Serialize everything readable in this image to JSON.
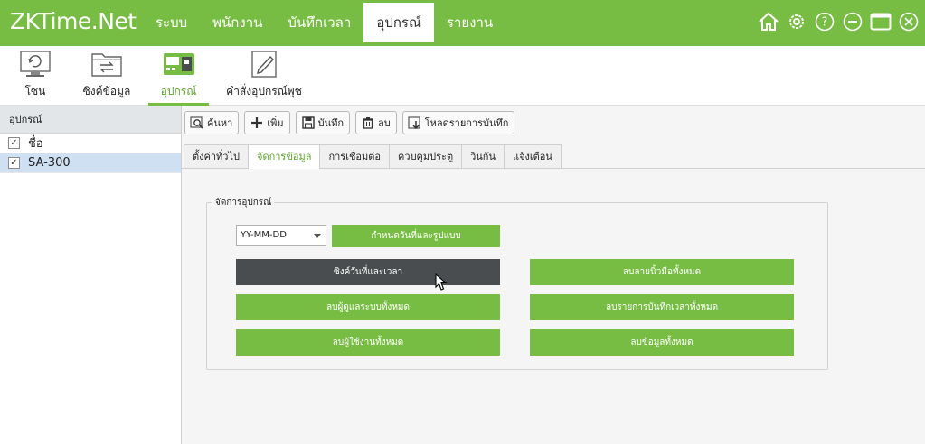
{
  "app": {
    "logo_main": "ZKTime",
    "logo_suffix": ".Net"
  },
  "nav": {
    "items": [
      {
        "label": "ระบบ"
      },
      {
        "label": "พนักงาน"
      },
      {
        "label": "บันทึกเวลา"
      },
      {
        "label": "อุปกรณ์"
      },
      {
        "label": "รายงาน"
      }
    ],
    "active_index": 3
  },
  "window_icons": [
    "home-icon",
    "gear-icon",
    "help-icon",
    "minimize-icon",
    "maximize-icon",
    "close-icon"
  ],
  "toolbar": {
    "items": [
      {
        "label": "โซน",
        "icon": "monitor-sync-icon"
      },
      {
        "label": "ซิงค์ข้อมูล",
        "icon": "folder-sync-icon"
      },
      {
        "label": "อุปกรณ์",
        "icon": "device-icon",
        "active": true
      },
      {
        "label": "คำสั่งอุปกรณ์พุช",
        "icon": "edit-command-icon"
      }
    ]
  },
  "left_panel": {
    "header": "อุปกรณ์",
    "column_label": "ชื่อ",
    "rows": [
      {
        "name": "SA-300",
        "checked": true
      }
    ]
  },
  "actions": {
    "search": "ค้นหา",
    "add": "เพิ่ม",
    "save": "บันทึก",
    "delete": "ลบ",
    "download_records": "โหลดรายการบันทึก"
  },
  "tabs": {
    "items": [
      {
        "label": "ตั้งค่าทั่วไป"
      },
      {
        "label": "จัดการข้อมูล"
      },
      {
        "label": "การเชื่อมต่อ"
      },
      {
        "label": "ควบคุมประตู"
      },
      {
        "label": "วินกัน"
      },
      {
        "label": "แจ้งเตือน"
      }
    ],
    "active_index": 1
  },
  "device_mgmt": {
    "title": "จัดการอุปกรณ์",
    "date_format_value": "YY-MM-DD",
    "set_date_format": "กำหนดวันที่และรูปแบบ",
    "sync_datetime": "ซิงค์วันที่และเวลา",
    "clear_fingerprints": "ลบลายนิ้วมือทั้งหมด",
    "clear_admins": "ลบผู้ดูแลระบบทั้งหมด",
    "clear_attendance": "ลบรายการบันทึกเวลาทั้งหมด",
    "clear_users": "ลบผู้ใช้งานทั้งหมด",
    "clear_all_data": "ลบข้อมูลทั้งหมด"
  },
  "colors": {
    "brand_green": "#78bd43",
    "dark_button": "#4a4d4f",
    "active_tab_text": "#5fa52a"
  }
}
